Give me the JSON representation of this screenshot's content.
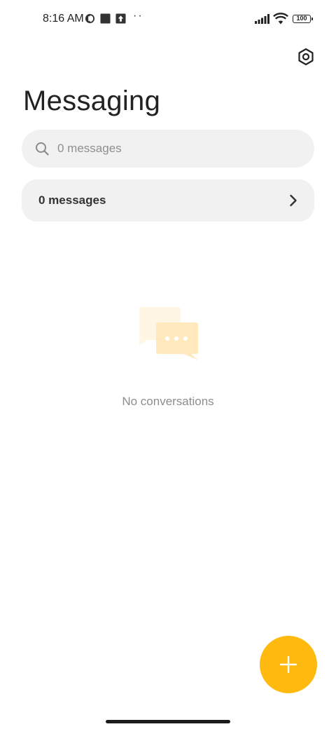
{
  "status_bar": {
    "time": "8:16 AM",
    "battery": "100",
    "overflow": "··",
    "icons": [
      "notification-app-icon",
      "square-notification-icon",
      "upload-notification-icon",
      "signal-icon",
      "wifi-icon",
      "battery-icon"
    ]
  },
  "header": {
    "title": "Messaging",
    "settings_icon": "settings-hexagon-icon"
  },
  "search": {
    "placeholder": "0 messages",
    "value": ""
  },
  "messages_row": {
    "label": "0 messages"
  },
  "empty_state": {
    "text": "No conversations",
    "icon": "chat-bubbles-icon"
  },
  "fab": {
    "icon": "plus-icon"
  },
  "colors": {
    "accent": "#ffb90f",
    "card_background": "#f1f1f1",
    "illustration_light": "#fff6e3",
    "illustration_mid": "#ffe9bd"
  }
}
